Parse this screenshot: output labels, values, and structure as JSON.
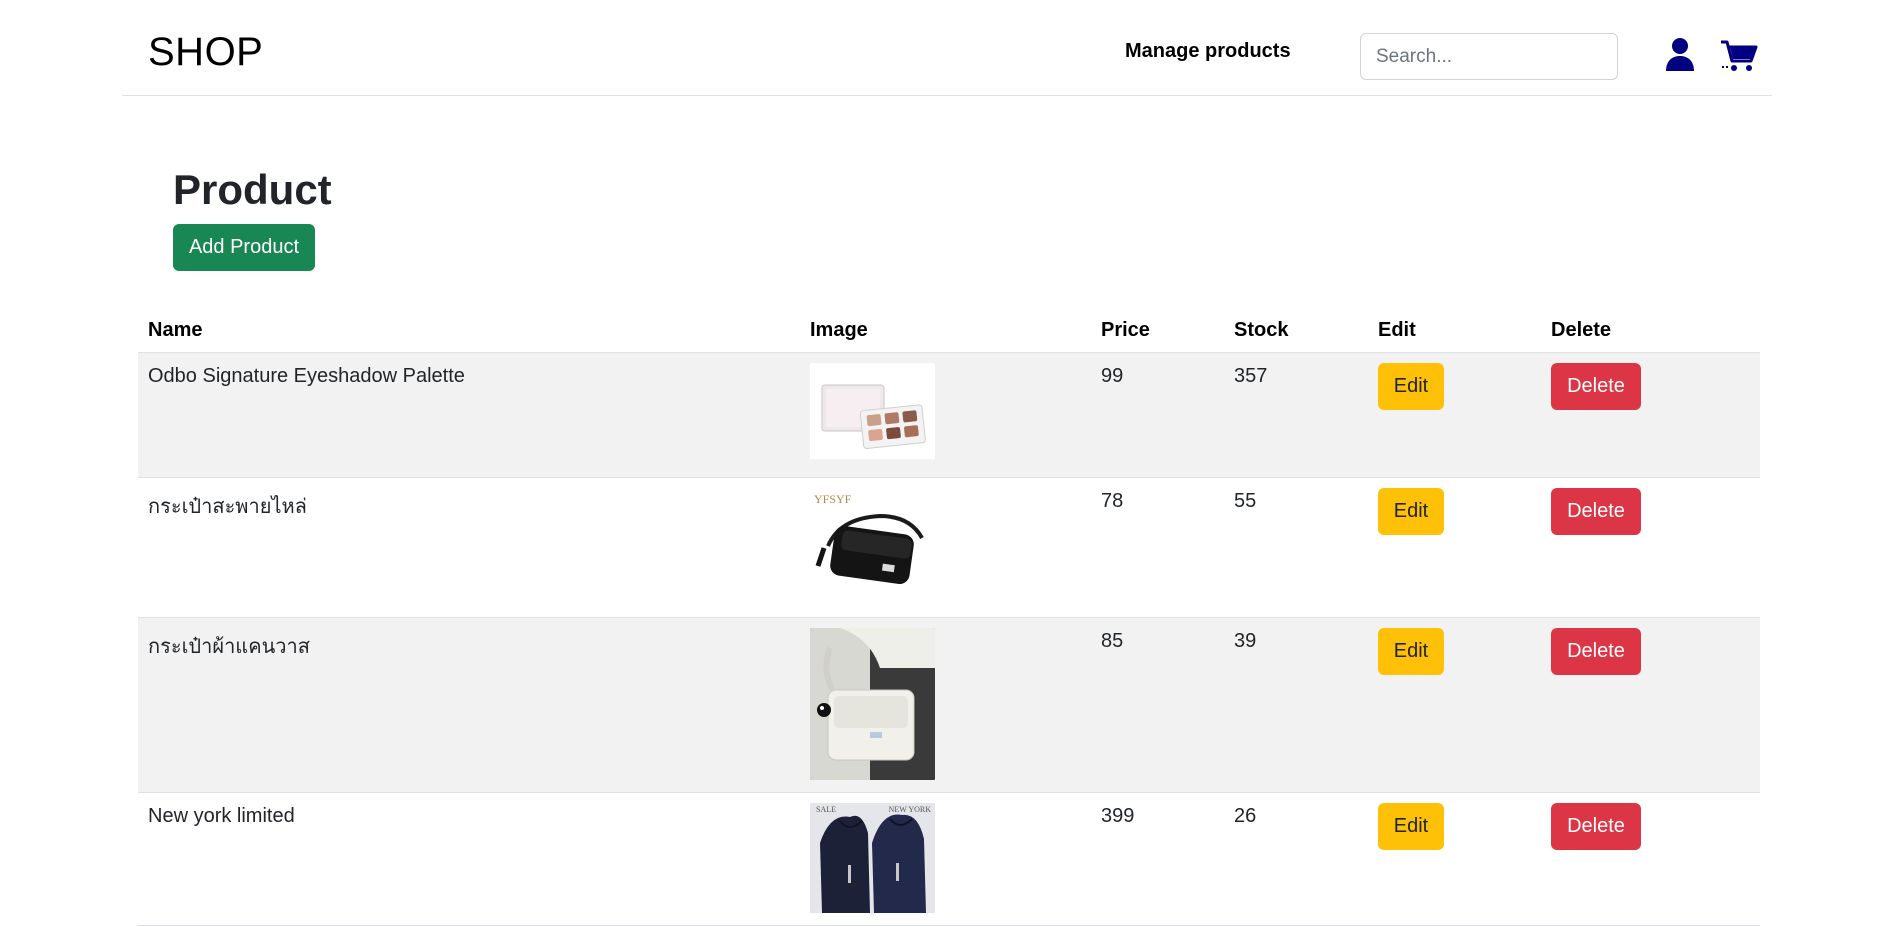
{
  "header": {
    "brand": "SHOP",
    "nav_link": "Manage products",
    "search_placeholder": "Search..."
  },
  "main": {
    "title": "Product",
    "add_button": "Add Product"
  },
  "table": {
    "columns": [
      "Name",
      "Image",
      "Price",
      "Stock",
      "Edit",
      "Delete"
    ],
    "rows": [
      {
        "name": "Odbo Signature Eyeshadow Palette",
        "image": "eyeshadow-palette-photo",
        "price": "99",
        "stock": "357",
        "edit": "Edit",
        "delete": "Delete"
      },
      {
        "name": "กระเป๋าสะพายไหล่",
        "image": "black-shoulder-bag-photo",
        "image_caption": "YFSYF",
        "price": "78",
        "stock": "55",
        "edit": "Edit",
        "delete": "Delete"
      },
      {
        "name": "กระเป๋าผ้าแคนวาส",
        "image": "canvas-bag-photo",
        "price": "85",
        "stock": "39",
        "edit": "Edit",
        "delete": "Delete"
      },
      {
        "name": "New york limited",
        "image": "navy-hoodie-photo",
        "image_caption_left": "SALE",
        "image_caption_right": "NEW YORK",
        "price": "399",
        "stock": "26",
        "edit": "Edit",
        "delete": "Delete"
      }
    ]
  },
  "colors": {
    "add": "#198754",
    "edit": "#ffc107",
    "delete": "#dc3545",
    "icon": "#000080"
  }
}
